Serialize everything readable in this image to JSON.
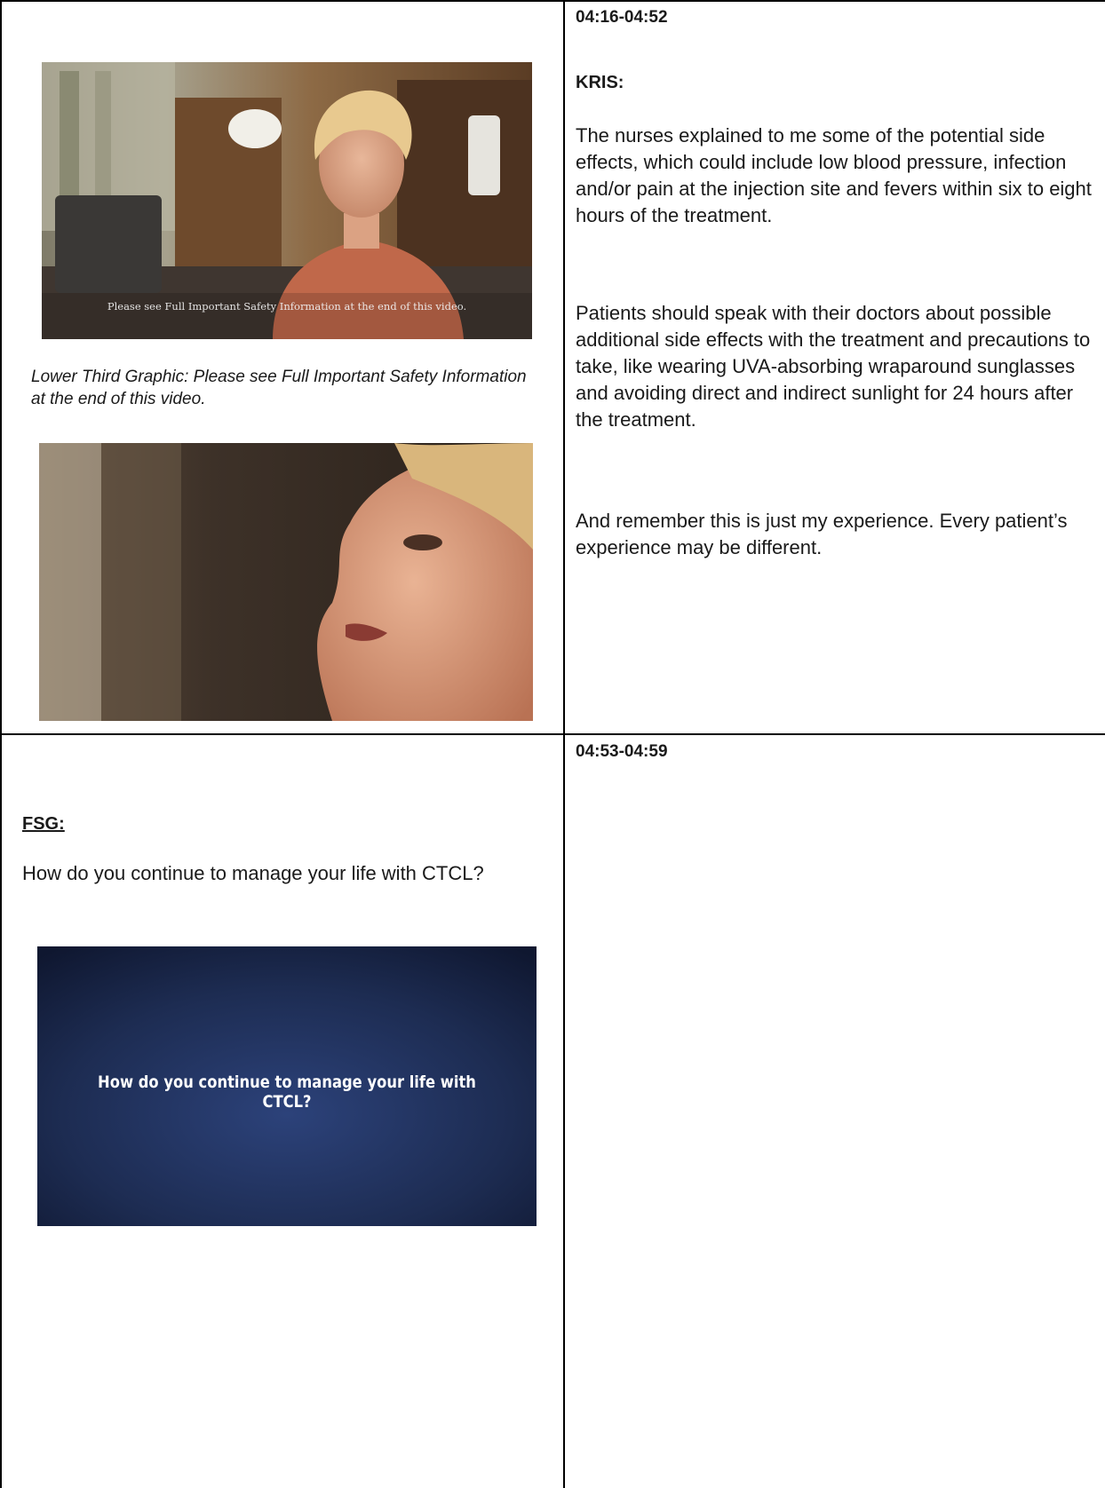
{
  "rows": [
    {
      "timecode": "04:16-04:52",
      "speaker": "KRIS:",
      "paragraphs": [
        "The nurses explained to me some of the potential side effects, which could include low blood pressure, infection and/or pain at the injection site and fevers within six to eight hours of the treatment.",
        "Patients should speak with their doctors about possible additional side effects with the treatment and precautions to take, like wearing UVA-absorbing wraparound sunglasses and avoiding direct and indirect sunlight for 24 hours after the treatment.",
        "And remember this is just my experience. Every patient’s experience may be different."
      ],
      "frame1_overlay_text": "Please see Full Important Safety Information at the end of this video.",
      "caption": "Lower Third Graphic: Please see Full Important Safety Information at the end of this video."
    },
    {
      "timecode": "04:53-04:59",
      "label": "FSG:",
      "question": "How do you continue to manage your life with CTCL?",
      "graphic_text": "How do you continue to manage your life with CTCL?"
    }
  ],
  "colors": {
    "blouse": "#c0684a",
    "fsg_background": "#1d2c52",
    "border": "#000000"
  }
}
